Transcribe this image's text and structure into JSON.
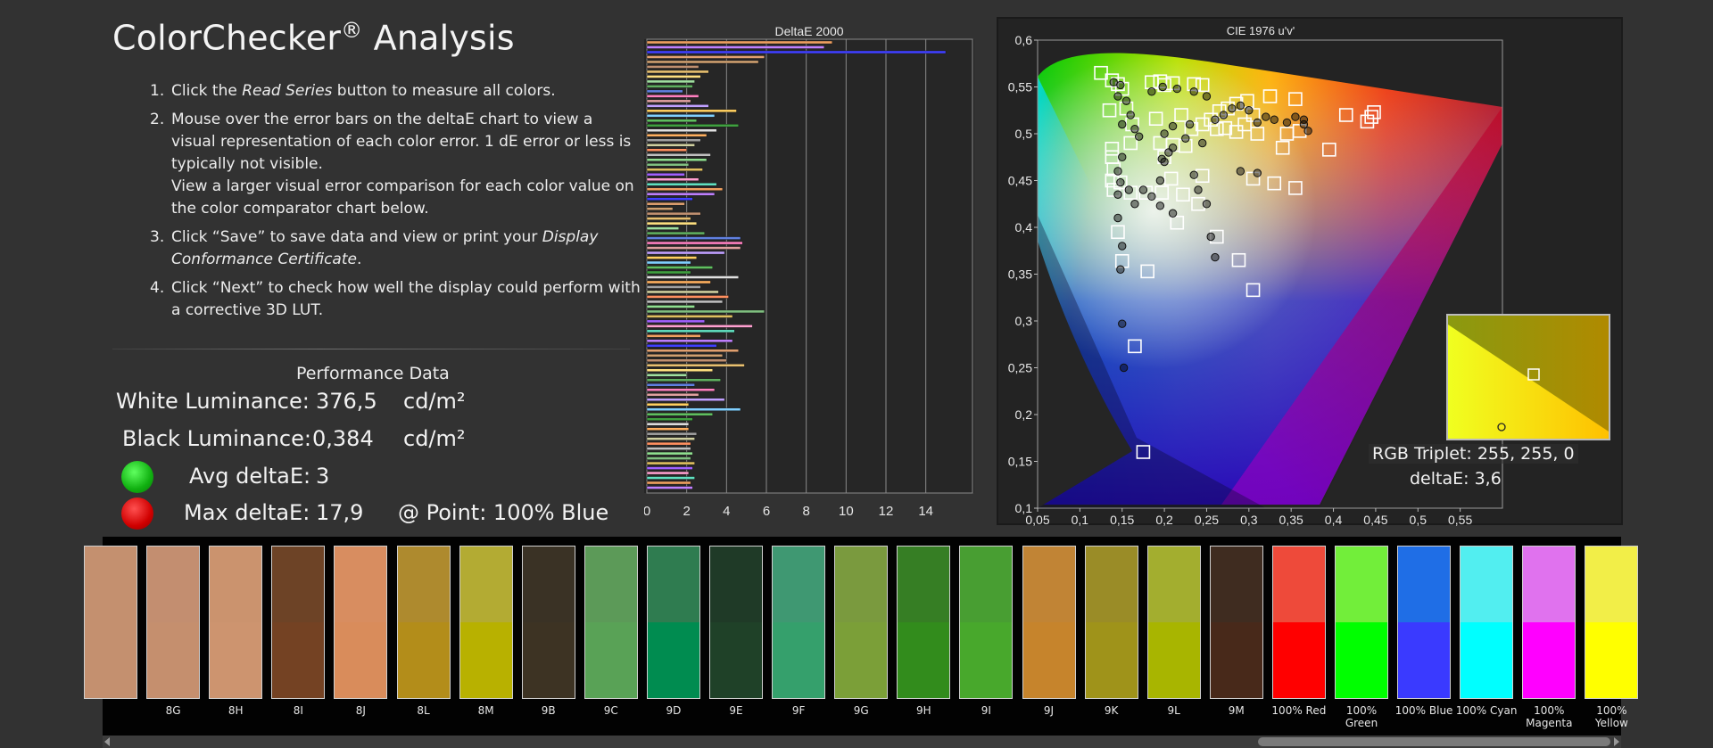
{
  "title": {
    "main": "ColorChecker",
    "reg": "®",
    "rest": " Analysis"
  },
  "instructions": [
    {
      "num": "1.",
      "parts": [
        [
          "Click the ",
          false
        ],
        [
          "Read Series",
          true
        ],
        [
          " button to measure all colors.",
          false
        ]
      ]
    },
    {
      "num": "2.",
      "parts": [
        [
          "Mouse over the error bars on the deltaE chart to view a visual representation of each color error. 1 dE error or less is typically not visible.",
          false
        ]
      ],
      "extra": "View a larger visual error comparison for each color value on the color comparator chart below."
    },
    {
      "num": "3.",
      "parts": [
        [
          "Click “Save” to save data and view or print your ",
          false
        ],
        [
          "Display Conformance Certificate",
          true
        ],
        [
          ".",
          false
        ]
      ]
    },
    {
      "num": "4.",
      "parts": [
        [
          "Click “Next” to check how well the display could perform with a corrective 3D LUT.",
          false
        ]
      ]
    }
  ],
  "performance": {
    "title": "Performance Data",
    "white_label": "White Luminance:",
    "white_value": "376,5",
    "white_unit": "cd/m²",
    "black_label": "Black Luminance:",
    "black_value": "0,384",
    "black_unit": "cd/m²",
    "avg_label": "Avg deltaE:",
    "avg_value": "3",
    "max_label": "Max deltaE:",
    "max_value": "17,9",
    "point_label": "@ Point: 100% Blue",
    "avg_status_color": "#10b010",
    "max_status_color": "#d00000"
  },
  "chart_data": [
    {
      "type": "bar",
      "orientation": "horizontal",
      "title": "DeltaE 2000",
      "xlim": [
        0,
        15
      ],
      "xticks": [
        "0",
        "2",
        "4",
        "6",
        "8",
        "10",
        "12",
        "14"
      ],
      "values": [
        9.3,
        8.9,
        15,
        5.9,
        5.6,
        2.6,
        3.1,
        2.7,
        2.4,
        2.3,
        1.8,
        2.6,
        2.2,
        3.1,
        4.5,
        3.4,
        2.5,
        4.6,
        3.5,
        3.0,
        2.7,
        2.4,
        2.0,
        3.2,
        3.0,
        2.1,
        2.8,
        1.9,
        2.6,
        3.5,
        3.8,
        3.4,
        2.3,
        1.9,
        1.3,
        2.7,
        2.2,
        2.5,
        1.6,
        2.9,
        4.7,
        4.8,
        4.7,
        3.9,
        2.5,
        2.2,
        3.3,
        2.2,
        4.6,
        3.2,
        2.7,
        3.6,
        4.1,
        3.8,
        2.4,
        5.9,
        4.3,
        2.9,
        5.3,
        4.4,
        2.7,
        4.3,
        3.5,
        4.6,
        3.8,
        4.0,
        4.9,
        3.3,
        2.0,
        3.7,
        2.4,
        3.4,
        2.6,
        3.9,
        2.1,
        4.7,
        3.3,
        2.3,
        2.1,
        2.1,
        2.5,
        2.4,
        2.2,
        2.2,
        2.3,
        2.2,
        2.4,
        2.3,
        2.1,
        2.4,
        2.2,
        2.3
      ]
    },
    {
      "type": "scatter",
      "title": "CIE 1976 u'v'",
      "xlim": [
        0.05,
        0.6
      ],
      "ylim": [
        0.1,
        0.6
      ],
      "xticks": [
        "0,05",
        "0,1",
        "0,15",
        "0,2",
        "0,25",
        "0,3",
        "0,35",
        "0,4",
        "0,45",
        "0,5",
        "0,55"
      ],
      "yticks": [
        "0,1",
        "0,15",
        "0,2",
        "0,25",
        "0,3",
        "0,35",
        "0,4",
        "0,45",
        "0,5",
        "0,55",
        "0,6"
      ],
      "series": [
        {
          "marker": "square",
          "points": [
            [
              0.125,
              0.565
            ],
            [
              0.138,
              0.557
            ],
            [
              0.145,
              0.553
            ],
            [
              0.15,
              0.548
            ],
            [
              0.135,
              0.525
            ],
            [
              0.155,
              0.527
            ],
            [
              0.162,
              0.51
            ],
            [
              0.16,
              0.49
            ],
            [
              0.138,
              0.484
            ],
            [
              0.138,
              0.475
            ],
            [
              0.14,
              0.462
            ],
            [
              0.138,
              0.45
            ],
            [
              0.14,
              0.44
            ],
            [
              0.148,
              0.448
            ],
            [
              0.16,
              0.437
            ],
            [
              0.178,
              0.437
            ],
            [
              0.197,
              0.437
            ],
            [
              0.145,
              0.395
            ],
            [
              0.15,
              0.364
            ],
            [
              0.18,
              0.353
            ],
            [
              0.165,
              0.273
            ],
            [
              0.175,
              0.16
            ],
            [
              0.185,
              0.555
            ],
            [
              0.195,
              0.556
            ],
            [
              0.2,
              0.552
            ],
            [
              0.21,
              0.554
            ],
            [
              0.235,
              0.553
            ],
            [
              0.245,
              0.552
            ],
            [
              0.19,
              0.516
            ],
            [
              0.22,
              0.52
            ],
            [
              0.195,
              0.49
            ],
            [
              0.21,
              0.488
            ],
            [
              0.225,
              0.487
            ],
            [
              0.232,
              0.505
            ],
            [
              0.245,
              0.51
            ],
            [
              0.255,
              0.515
            ],
            [
              0.265,
              0.524
            ],
            [
              0.275,
              0.527
            ],
            [
              0.285,
              0.532
            ],
            [
              0.298,
              0.535
            ],
            [
              0.325,
              0.54
            ],
            [
              0.355,
              0.537
            ],
            [
              0.295,
              0.51
            ],
            [
              0.285,
              0.502
            ],
            [
              0.272,
              0.506
            ],
            [
              0.262,
              0.505
            ],
            [
              0.305,
              0.52
            ],
            [
              0.31,
              0.5
            ],
            [
              0.345,
              0.5
            ],
            [
              0.36,
              0.503
            ],
            [
              0.34,
              0.485
            ],
            [
              0.395,
              0.483
            ],
            [
              0.415,
              0.52
            ],
            [
              0.44,
              0.513
            ],
            [
              0.445,
              0.518
            ],
            [
              0.448,
              0.523
            ],
            [
              0.208,
              0.452
            ],
            [
              0.222,
              0.435
            ],
            [
              0.245,
              0.455
            ],
            [
              0.24,
              0.425
            ],
            [
              0.215,
              0.405
            ],
            [
              0.262,
              0.39
            ],
            [
              0.288,
              0.365
            ],
            [
              0.305,
              0.333
            ],
            [
              0.305,
              0.452
            ],
            [
              0.33,
              0.447
            ],
            [
              0.355,
              0.442
            ],
            [
              0.2,
              0.475
            ]
          ]
        },
        {
          "marker": "circle",
          "points": [
            [
              0.14,
              0.555
            ],
            [
              0.148,
              0.552
            ],
            [
              0.145,
              0.54
            ],
            [
              0.155,
              0.535
            ],
            [
              0.16,
              0.52
            ],
            [
              0.15,
              0.51
            ],
            [
              0.165,
              0.505
            ],
            [
              0.17,
              0.497
            ],
            [
              0.15,
              0.475
            ],
            [
              0.145,
              0.46
            ],
            [
              0.148,
              0.448
            ],
            [
              0.158,
              0.44
            ],
            [
              0.145,
              0.435
            ],
            [
              0.165,
              0.425
            ],
            [
              0.175,
              0.44
            ],
            [
              0.195,
              0.45
            ],
            [
              0.185,
              0.433
            ],
            [
              0.195,
              0.423
            ],
            [
              0.21,
              0.415
            ],
            [
              0.145,
              0.41
            ],
            [
              0.15,
              0.38
            ],
            [
              0.148,
              0.355
            ],
            [
              0.15,
              0.297
            ],
            [
              0.152,
              0.25
            ],
            [
              0.185,
              0.545
            ],
            [
              0.198,
              0.55
            ],
            [
              0.215,
              0.548
            ],
            [
              0.235,
              0.545
            ],
            [
              0.25,
              0.54
            ],
            [
              0.2,
              0.5
            ],
            [
              0.21,
              0.508
            ],
            [
              0.23,
              0.51
            ],
            [
              0.225,
              0.495
            ],
            [
              0.205,
              0.48
            ],
            [
              0.21,
              0.485
            ],
            [
              0.245,
              0.49
            ],
            [
              0.26,
              0.515
            ],
            [
              0.27,
              0.52
            ],
            [
              0.28,
              0.527
            ],
            [
              0.29,
              0.53
            ],
            [
              0.3,
              0.525
            ],
            [
              0.31,
              0.512
            ],
            [
              0.32,
              0.518
            ],
            [
              0.33,
              0.515
            ],
            [
              0.345,
              0.512
            ],
            [
              0.355,
              0.518
            ],
            [
              0.365,
              0.51
            ],
            [
              0.37,
              0.503
            ],
            [
              0.365,
              0.515
            ],
            [
              0.235,
              0.456
            ],
            [
              0.24,
              0.44
            ],
            [
              0.25,
              0.425
            ],
            [
              0.255,
              0.39
            ],
            [
              0.26,
              0.368
            ],
            [
              0.29,
              0.46
            ],
            [
              0.31,
              0.458
            ],
            [
              0.2,
              0.47
            ],
            [
              0.197,
              0.473
            ]
          ]
        }
      ]
    }
  ],
  "inset": {
    "triplet_label": "RGB Triplet: 255, 255, 0",
    "delta_label": "deltaE: 3,6"
  },
  "swatches": [
    {
      "label": "",
      "top": "#c4906f",
      "bottom": "#c4906f"
    },
    {
      "label": "8G",
      "top": "#c38e70",
      "bottom": "#c58f6e"
    },
    {
      "label": "8H",
      "top": "#cb936e",
      "bottom": "#cd946f"
    },
    {
      "label": "8I",
      "top": "#6d4326",
      "bottom": "#744223"
    },
    {
      "label": "8J",
      "top": "#d88d60",
      "bottom": "#d98c5b"
    },
    {
      "label": "8L",
      "top": "#ae8a2e",
      "bottom": "#b38d1a"
    },
    {
      "label": "8M",
      "top": "#b3ab33",
      "bottom": "#b8b100"
    },
    {
      "label": "9B",
      "top": "#3a3225",
      "bottom": "#3d3323"
    },
    {
      "label": "9C",
      "top": "#5c9a58",
      "bottom": "#59a256"
    },
    {
      "label": "9D",
      "top": "#2f7c50",
      "bottom": "#008c50"
    },
    {
      "label": "9E",
      "top": "#1f3a27",
      "bottom": "#1f4128"
    },
    {
      "label": "9F",
      "top": "#3f9872",
      "bottom": "#35a06c"
    },
    {
      "label": "9G",
      "top": "#7a9a3e",
      "bottom": "#7b9f38"
    },
    {
      "label": "9H",
      "top": "#367e24",
      "bottom": "#328c1c"
    },
    {
      "label": "9I",
      "top": "#489e32",
      "bottom": "#48a82c"
    },
    {
      "label": "9J",
      "top": "#c18435",
      "bottom": "#c6842c"
    },
    {
      "label": "9K",
      "top": "#9a8c27",
      "bottom": "#9f931a"
    },
    {
      "label": "9L",
      "top": "#a3ae2f",
      "bottom": "#a8b500"
    },
    {
      "label": "9M",
      "top": "#3f2c20",
      "bottom": "#48291a"
    },
    {
      "label": "100% Red",
      "top": "#ee4a3a",
      "bottom": "#ff0000"
    },
    {
      "label": "100% Green",
      "top": "#72ee3a",
      "bottom": "#00ff00"
    },
    {
      "label": "100% Blue",
      "top": "#1f6ee6",
      "bottom": "#3a3aff"
    },
    {
      "label": "100% Cyan",
      "top": "#52eef0",
      "bottom": "#00ffff"
    },
    {
      "label": "100% Magenta",
      "top": "#e072ee",
      "bottom": "#ff00ff"
    },
    {
      "label": "100% Yellow",
      "top": "#f2ee48",
      "bottom": "#ffff00"
    }
  ]
}
